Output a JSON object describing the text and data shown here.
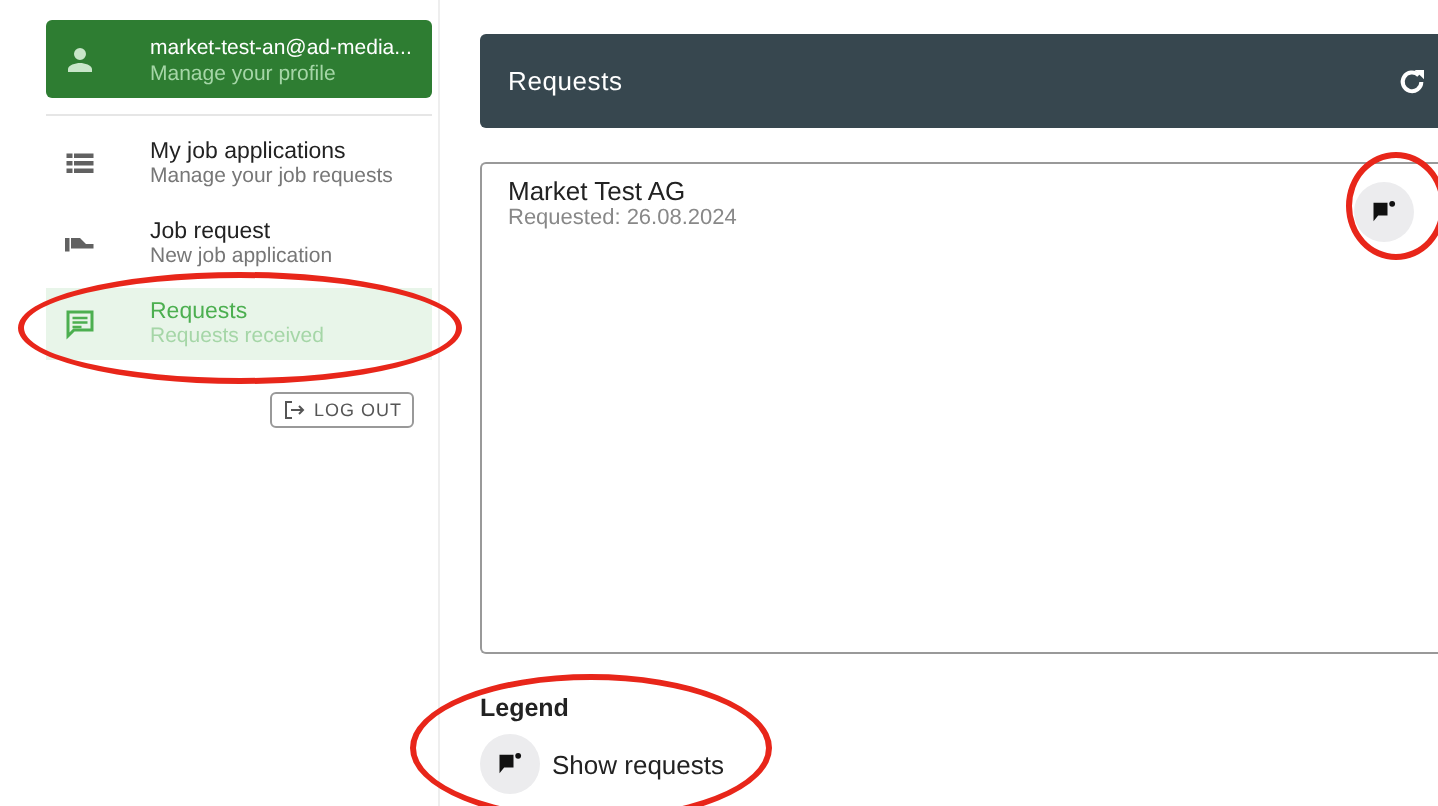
{
  "profile": {
    "email": "market-test-an@ad-media...",
    "subtitle": "Manage your profile"
  },
  "nav": [
    {
      "kind": "list",
      "label": "My job applications",
      "subtitle": "Manage your job requests",
      "selected": false,
      "circled": false
    },
    {
      "kind": "hand",
      "label": "Job request",
      "subtitle": "New job application",
      "selected": false,
      "circled": false
    },
    {
      "kind": "chat",
      "label": "Requests",
      "subtitle": "Requests received",
      "selected": true,
      "circled": true
    }
  ],
  "logout": {
    "label": "LOG OUT"
  },
  "header": {
    "title": "Requests"
  },
  "requests": [
    {
      "company": "Market Test AG",
      "date": "Requested: 26.08.2024",
      "circled": true
    }
  ],
  "legend": {
    "title": "Legend",
    "items": [
      {
        "label": "Show requests",
        "circled": true
      }
    ]
  }
}
